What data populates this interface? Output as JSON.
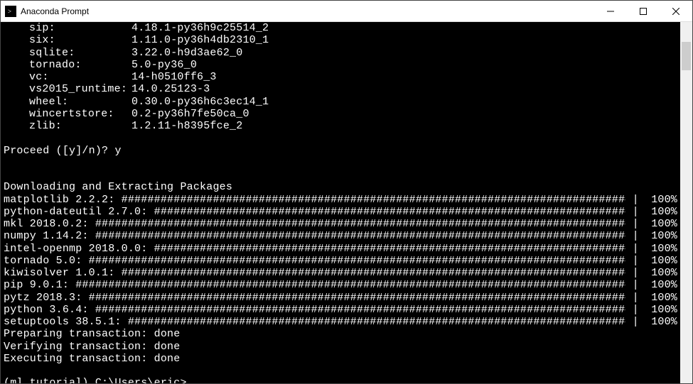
{
  "window": {
    "title": "Anaconda Prompt"
  },
  "packages": [
    {
      "name": "sip:",
      "version": "4.18.1-py36h9c25514_2"
    },
    {
      "name": "six:",
      "version": "1.11.0-py36h4db2310_1"
    },
    {
      "name": "sqlite:",
      "version": "3.22.0-h9d3ae62_0"
    },
    {
      "name": "tornado:",
      "version": "5.0-py36_0"
    },
    {
      "name": "vc:",
      "version": "14-h0510ff6_3"
    },
    {
      "name": "vs2015_runtime:",
      "version": "14.0.25123-3"
    },
    {
      "name": "wheel:",
      "version": "0.30.0-py36h6c3ec14_1"
    },
    {
      "name": "wincertstore:",
      "version": "0.2-py36h7fe50ca_0"
    },
    {
      "name": "zlib:",
      "version": "1.2.11-h8395fce_2"
    }
  ],
  "proceed": {
    "prompt": "Proceed ([y]/n)? ",
    "answer": "y"
  },
  "downloading_header": "Downloading and Extracting Packages",
  "downloads": [
    {
      "label": "matplotlib 2.2.2: ",
      "pct": "100%"
    },
    {
      "label": "python-dateutil 2.7.0: ",
      "pct": "100%"
    },
    {
      "label": "mkl 2018.0.2: ",
      "pct": "100%"
    },
    {
      "label": "numpy 1.14.2: ",
      "pct": "100%"
    },
    {
      "label": "intel-openmp 2018.0.0: ",
      "pct": "100%"
    },
    {
      "label": "tornado 5.0: ",
      "pct": "100%"
    },
    {
      "label": "kiwisolver 1.0.1: ",
      "pct": "100%"
    },
    {
      "label": "pip 9.0.1: ",
      "pct": "100%"
    },
    {
      "label": "pytz 2018.3: ",
      "pct": "100%"
    },
    {
      "label": "python 3.6.4: ",
      "pct": "100%"
    },
    {
      "label": "setuptools 38.5.1: ",
      "pct": "100%"
    }
  ],
  "transactions": [
    "Preparing transaction: done",
    "Verifying transaction: done",
    "Executing transaction: done"
  ],
  "prompt_line": "(ml_tutorial) C:\\Users\\eric>",
  "bar_sep": " | "
}
